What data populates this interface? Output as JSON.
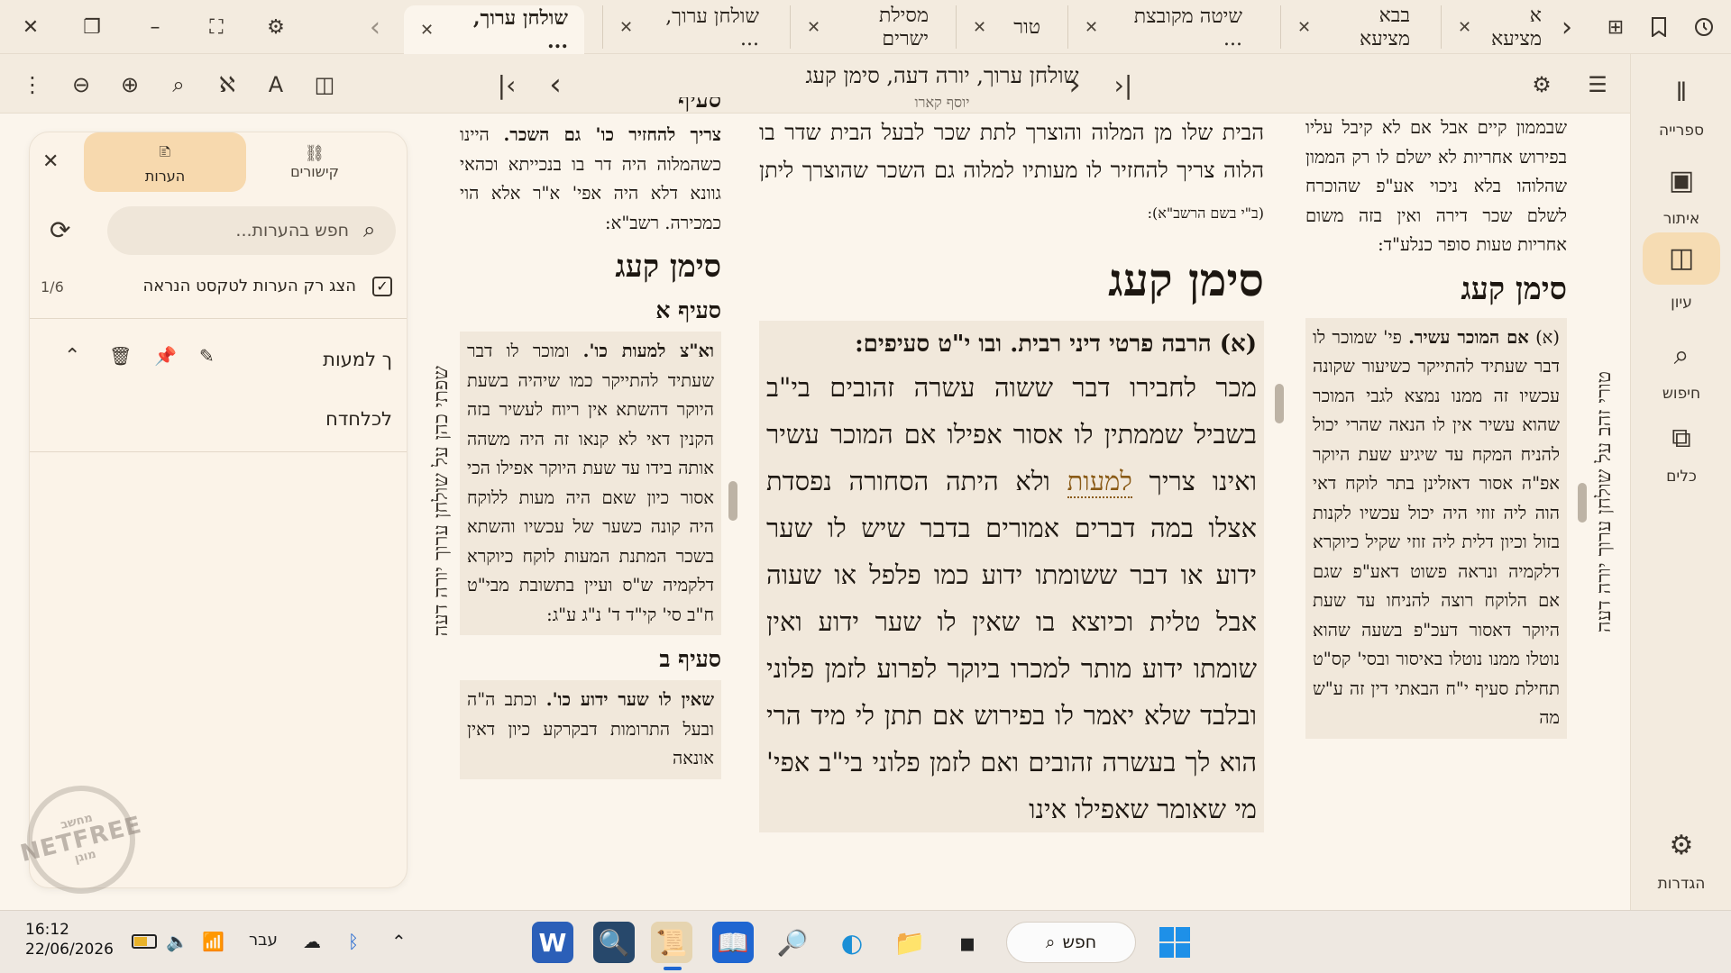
{
  "tabs": [
    {
      "label": "שולחן ערוך, ..."
    },
    {
      "label": "שולחן ערוך, ..."
    },
    {
      "label": "מסילת ישרים"
    },
    {
      "label": "טור"
    },
    {
      "label": "שיטה מקובצת ..."
    },
    {
      "label": "בבא מציעא"
    },
    {
      "label": "א מציעא"
    }
  ],
  "icons": {
    "close": "✕",
    "restore": "❐",
    "minimize": "–",
    "fullscreen": "⛶",
    "settings": "⚙",
    "chev_left": "‹",
    "chev_right": "›",
    "new_tab": "⊞",
    "bookmark": "🔖",
    "history": "🕓",
    "more": "⋮",
    "zoom_out": "⊖",
    "zoom_in": "⊕",
    "search": "⌕",
    "aleph": "ℵ",
    "font": "A",
    "split": "◫",
    "first": "|‹",
    "prev": "‹",
    "next": "›",
    "last": "›|",
    "menu": "☰"
  },
  "document": {
    "title": "שולחן ערוך, יורה דעה, סימן קעג",
    "subtitle": "יוסף קארו"
  },
  "nav": [
    {
      "label": "ספרייה",
      "icon": "𝍪"
    },
    {
      "label": "איתור",
      "icon": "▣"
    },
    {
      "label": "עיון",
      "icon": "◫"
    },
    {
      "label": "חיפוש",
      "icon": "⌕"
    },
    {
      "label": "כלים",
      "icon": "⧉"
    },
    {
      "label": "הגדרות",
      "icon": "⚙"
    }
  ],
  "notes_panel": {
    "tab_links": "קישורים",
    "tab_notes": "הערות",
    "search_placeholder": "חפש בהערות...",
    "filter_label": "הצג רק הערות לטקסט הנראה",
    "count": "1/6",
    "note_items": [
      "ך למעות",
      "לכלחדח"
    ]
  },
  "left_column": {
    "vertical_title": "שפתי כהן על שולחן ערוך יורה דעה",
    "top_text": "סעיף",
    "intro_bold": "צריך להחזיר כו' גם השכר.",
    "intro": " היינו כשהמלוה היה דר בו בנכייתא וכהאי גוונא דלא היה אפי' א\"ר אלא הוי כמכירה. רשב\"א:",
    "heading": "סימן קעג",
    "seif_a": "סעיף א",
    "para_a_bold": "וא\"צ למעות כו'.",
    "para_a": " ומוכר לו דבר שעתיד להתייקר כמו שיהיה בשעת היוקר דהשתא אין ריוח לעשיר בזה הקנין דאי לא קנאו זה היה משהה אותה בידו עד שעת היוקר אפילו הכי אסור כיון שאם היה מעות ללוקח היה קונה כשער של עכשיו והשתא בשכר המתנת המעות לוקח כיוקרא דלקמיה ש\"ס ועיין בתשובת מבי\"ט ח\"ב סי' קי\"ד ד' נ\"ג ע\"ג:",
    "seif_b": "סעיף ב",
    "para_b_bold": "שאין לו שער ידוע כו'.",
    "para_b": " וכתב ה\"ה ובעל התרומות דבקרקע כיון דאין אונאה"
  },
  "center_column": {
    "top_text": "הבית שלו מן המלוה והוצרך לתת שכר לבעל הבית שדר בו הלוה צריך להחזיר לו מעותיו למלוה גם השכר שהוצרך ליתן",
    "top_small": " (ב\"י בשם הרשב\"א):",
    "heading": "סימן קעג",
    "summary": "(א) הרבה פרטי דיני רבית. ובו י\"ט סעיפים:",
    "body_1": "מכר לחבירו דבר ששוה עשרה זהובים בי\"ב בשביל שממתין לו אסור אפילו אם המוכר עשיר ואינו צריך ",
    "body_link": "למעות",
    "body_2": " ולא היתה הסחורה נפסדת אצלו במה דברים אמורים בדבר שיש לו שער ידוע או דבר ששומתו ידוע כמו פלפל או שעוה אבל טלית וכיוצא בו שאין לו שער ידוע ואין שומתו ידוע מותר למכרו ביוקר לפרוע לזמן פלוני ובלבד שלא יאמר לו בפירוש אם תתן לי מיד הרי הוא לך בעשרה זהובים ואם לזמן פלוני בי\"ב אפי' מי שאומר שאפילו אינו"
  },
  "right_column": {
    "vertical_title": "טורי זהב על שולחן ערוך יורה דעה",
    "top_text": "שבממון קיים אבל אם לא קיבל עליו בפירוש אחריות לא ישלם לו רק הממון שהלוהו בלא ניכוי אע\"פ שהוכרח לשלם שכר דירה ואין בזה משום אחריות טעות סופר כנלע\"ד:",
    "heading": "סימן קעג",
    "para_prefix": "(א) ",
    "para_bold": "אם המוכר עשיר.",
    "para": " פי' שמוכר לו דבר שעתיד להתייקר כשיעור שקונה עכשיו זה ממנו נמצא לגבי המוכר שהוא עשיר אין לו הנאה שהרי יכול להניח המקח עד שיגיע שעת היוקר אפ\"ה אסור דאזלינן בתר לוקח דאי הוה ליה זוזי היה יכול עכשיו לקנות בזול וכיון דלית ליה זוזי שקיל כיוקרא דלקמיה ונראה פשוט דאע\"פ שגם אם הלוקח רוצה להניחו עד שעת היוקר דאסור דעכ\"פ בשעה שהוא נוטלו ממנו נוטלו באיסור ובסי' קס\"ט תחילת סעיף י\"ח הבאתי דין זה ע\"ש מה"
  },
  "watermark": {
    "top": "מחשב",
    "mid": "NETFREE",
    "bot": "מוגן"
  },
  "taskbar": {
    "time": "16:12",
    "date": "22/06/2026",
    "lang": "עבר",
    "search_label": "חפש"
  }
}
